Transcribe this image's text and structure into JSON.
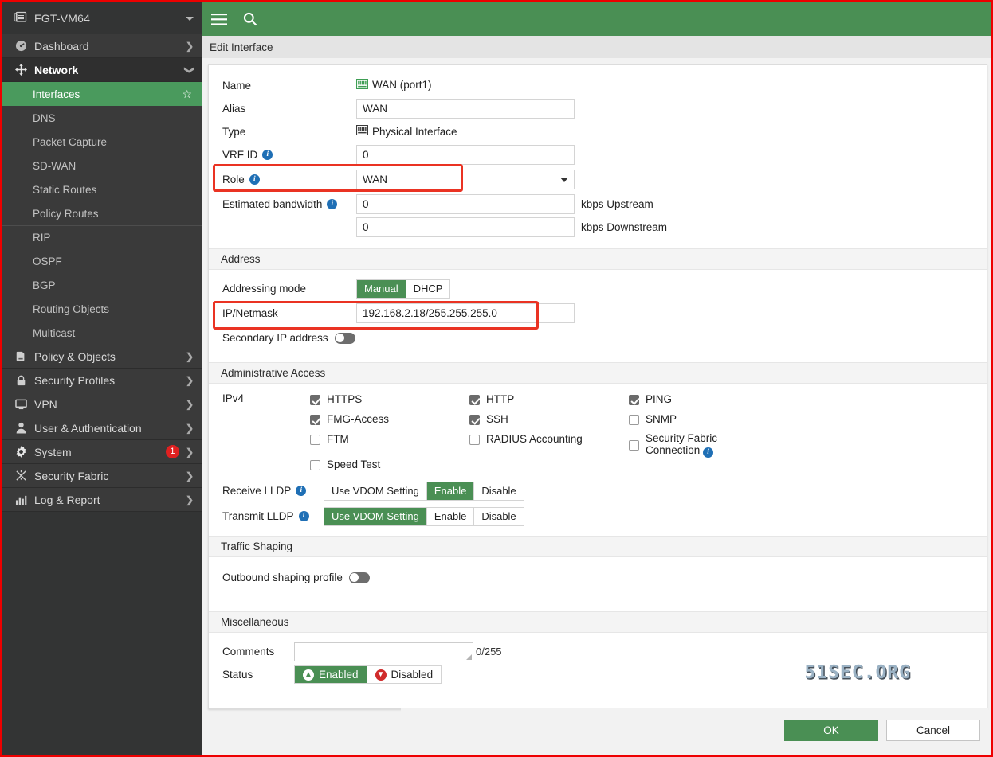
{
  "sidebar": {
    "brand": {
      "label": "FGT-VM64",
      "icon": "device-icon",
      "caret": "chevron-down-icon"
    },
    "items": [
      {
        "label": "Dashboard",
        "icon": "dashboard-icon",
        "expanded": false
      },
      {
        "label": "Network",
        "icon": "network-icon",
        "expanded": true,
        "active": true
      },
      {
        "label": "Policy & Objects",
        "icon": "policy-icon"
      },
      {
        "label": "Security Profiles",
        "icon": "lock-icon"
      },
      {
        "label": "VPN",
        "icon": "monitor-icon"
      },
      {
        "label": "User & Authentication",
        "icon": "user-icon"
      },
      {
        "label": "System",
        "icon": "gear-icon",
        "badge": "1"
      },
      {
        "label": "Security Fabric",
        "icon": "fabric-icon"
      },
      {
        "label": "Log & Report",
        "icon": "chart-icon"
      }
    ],
    "network_children": [
      {
        "label": "Interfaces",
        "selected": true,
        "starred": true
      },
      {
        "label": "DNS"
      },
      {
        "label": "Packet Capture"
      },
      {
        "label": "SD-WAN",
        "divider": true
      },
      {
        "label": "Static Routes"
      },
      {
        "label": "Policy Routes"
      },
      {
        "label": "RIP",
        "divider": true
      },
      {
        "label": "OSPF"
      },
      {
        "label": "BGP"
      },
      {
        "label": "Routing Objects"
      },
      {
        "label": "Multicast"
      }
    ]
  },
  "topbar": {
    "menu_icon": "hamburger-icon",
    "search_icon": "search-icon"
  },
  "breadcrumb": {
    "title": "Edit Interface"
  },
  "form": {
    "name": {
      "label": "Name",
      "value": "WAN (port1)"
    },
    "alias": {
      "label": "Alias",
      "value": "WAN"
    },
    "type": {
      "label": "Type",
      "value": "Physical Interface"
    },
    "vrf_id": {
      "label": "VRF ID",
      "value": "0"
    },
    "role": {
      "label": "Role",
      "value": "WAN"
    },
    "bandwidth": {
      "label": "Estimated bandwidth",
      "upstream_value": "0",
      "upstream_unit": "kbps Upstream",
      "downstream_value": "0",
      "downstream_unit": "kbps Downstream"
    }
  },
  "address": {
    "heading": "Address",
    "mode_label": "Addressing mode",
    "mode_options": [
      "Manual",
      "DHCP"
    ],
    "mode_selected": "Manual",
    "ip_label": "IP/Netmask",
    "ip_value": "192.168.2.18/255.255.255.0",
    "secondary_label": "Secondary IP address",
    "secondary_enabled": false
  },
  "admin_access": {
    "heading": "Administrative Access",
    "ipv4_label": "IPv4",
    "columns": [
      [
        {
          "label": "HTTPS",
          "checked": true
        },
        {
          "label": "FMG-Access",
          "checked": true
        },
        {
          "label": "FTM",
          "checked": false
        },
        {
          "label": "Speed Test",
          "checked": false
        }
      ],
      [
        {
          "label": "HTTP",
          "checked": true
        },
        {
          "label": "SSH",
          "checked": true
        },
        {
          "label": "RADIUS Accounting",
          "checked": false
        }
      ],
      [
        {
          "label": "PING",
          "checked": true
        },
        {
          "label": "SNMP",
          "checked": false
        },
        {
          "label": "Security Fabric Connection",
          "checked": false,
          "info": true
        }
      ]
    ],
    "receive_lldp": {
      "label": "Receive LLDP",
      "options": [
        "Use VDOM Setting",
        "Enable",
        "Disable"
      ],
      "selected": "Enable"
    },
    "transmit_lldp": {
      "label": "Transmit LLDP",
      "options": [
        "Use VDOM Setting",
        "Enable",
        "Disable"
      ],
      "selected": "Use VDOM Setting"
    }
  },
  "traffic_shaping": {
    "heading": "Traffic Shaping",
    "outbound_label": "Outbound shaping profile",
    "outbound_enabled": false
  },
  "miscellaneous": {
    "heading": "Miscellaneous",
    "comments_label": "Comments",
    "comments_value": "",
    "comments_counter": "0/255",
    "status_label": "Status",
    "status_options": [
      "Enabled",
      "Disabled"
    ],
    "status_selected": "Enabled"
  },
  "watermark": {
    "text": "51SEC.ORG"
  },
  "footer": {
    "ok_label": "OK",
    "cancel_label": "Cancel"
  },
  "colors": {
    "accent_green": "#4a8f54",
    "sidebar_bg": "#333434",
    "highlight_red": "#ea3323",
    "badge_red": "#e02020",
    "info_blue": "#1f6fb5"
  }
}
